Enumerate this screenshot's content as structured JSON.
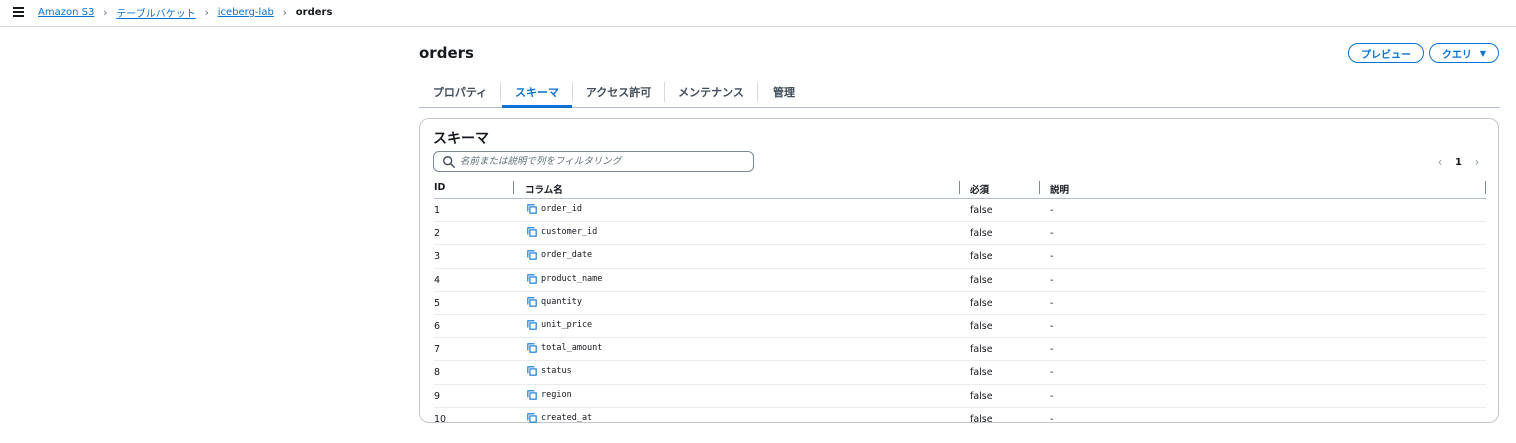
{
  "breadcrumb": {
    "items": [
      "Amazon S3",
      "テーブルバケット",
      "iceberg-lab"
    ],
    "current": "orders"
  },
  "header": {
    "title": "orders",
    "preview_label": "プレビュー",
    "query_label": "クエリ"
  },
  "tabs": [
    {
      "label": "プロパティ",
      "active": false
    },
    {
      "label": "スキーマ",
      "active": true
    },
    {
      "label": "アクセス許可",
      "active": false
    },
    {
      "label": "メンテナンス",
      "active": false
    },
    {
      "label": "管理",
      "active": false
    }
  ],
  "schema": {
    "title": "スキーマ",
    "search_placeholder": "名前または説明で列をフィルタリング",
    "pagination": {
      "current_page": "1"
    },
    "columns": {
      "id": "ID",
      "name": "コラム名",
      "required": "必須",
      "description": "説明"
    },
    "rows": [
      {
        "id": "1",
        "name": "order_id",
        "required": "false",
        "description": "-"
      },
      {
        "id": "2",
        "name": "customer_id",
        "required": "false",
        "description": "-"
      },
      {
        "id": "3",
        "name": "order_date",
        "required": "false",
        "description": "-"
      },
      {
        "id": "4",
        "name": "product_name",
        "required": "false",
        "description": "-"
      },
      {
        "id": "5",
        "name": "quantity",
        "required": "false",
        "description": "-"
      },
      {
        "id": "6",
        "name": "unit_price",
        "required": "false",
        "description": "-"
      },
      {
        "id": "7",
        "name": "total_amount",
        "required": "false",
        "description": "-"
      },
      {
        "id": "8",
        "name": "status",
        "required": "false",
        "description": "-"
      },
      {
        "id": "9",
        "name": "region",
        "required": "false",
        "description": "-"
      },
      {
        "id": "10",
        "name": "created_at",
        "required": "false",
        "description": "-"
      }
    ]
  },
  "colors": {
    "accent": "#0972d3",
    "text": "#16191f",
    "border": "#c6c6cd"
  }
}
